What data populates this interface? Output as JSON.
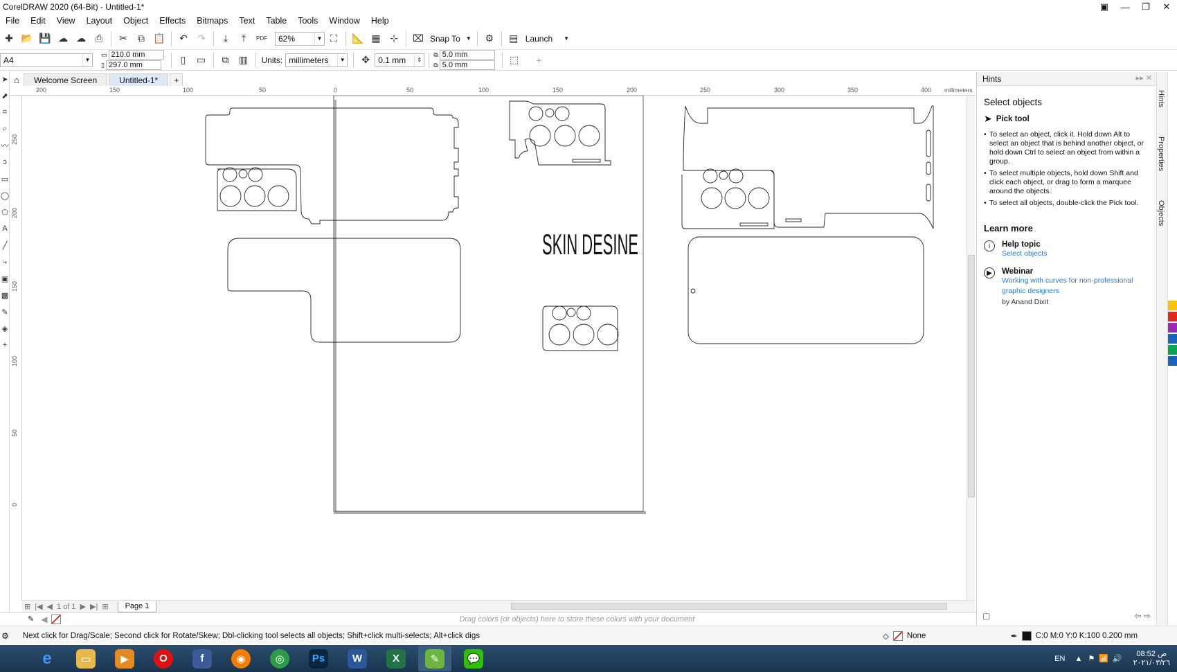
{
  "app": {
    "title": "CorelDRAW 2020 (64-Bit) - Untitled-1*"
  },
  "menu": [
    "File",
    "Edit",
    "View",
    "Layout",
    "Object",
    "Effects",
    "Bitmaps",
    "Text",
    "Table",
    "Tools",
    "Window",
    "Help"
  ],
  "toolbar": {
    "zoom": "62%",
    "snap_to": "Snap To",
    "launch": "Launch",
    "pdf": "PDF"
  },
  "property_bar": {
    "page_preset": "A4",
    "width": "210.0 mm",
    "height": "297.0 mm",
    "units_label": "Units:",
    "units_value": "millimeters",
    "nudge": "0.1 mm",
    "dup_x": "5.0 mm",
    "dup_y": "5.0 mm"
  },
  "doc_tabs": [
    "Welcome Screen",
    "Untitled-1*"
  ],
  "ruler": {
    "unit": "millimeters",
    "h_ticks": [
      "200",
      "150",
      "100",
      "50",
      "0",
      "50",
      "100",
      "150",
      "200",
      "250",
      "300",
      "350",
      "400"
    ],
    "v_ticks": [
      "250",
      "200",
      "150",
      "100",
      "50",
      "0"
    ]
  },
  "canvas": {
    "text": "SKIN DESINE"
  },
  "page_nav": {
    "count": "1 of 1",
    "page_tab": "Page 1"
  },
  "palette_hint": "Drag colors (or objects) here to store these colors with your document",
  "status": {
    "message": "Next click for Drag/Scale; Second click for Rotate/Skew; Dbl-clicking tool selects all objects; Shift+click multi-selects; Alt+click digs",
    "fill": "None",
    "outline": "C:0 M:0 Y:0 K:100  0.200 mm"
  },
  "hints": {
    "panel_title": "Hints",
    "heading": "Select objects",
    "tool": "Pick tool",
    "bullets": [
      "To select an object, click it. Hold down Alt to select an object that is behind another object, or hold down Ctrl to select an object from within a group.",
      "To select multiple objects, hold down Shift and click each object, or drag to form a marquee around the objects.",
      "To select all objects, double-click the Pick tool."
    ],
    "learn_more": "Learn more",
    "help_topic": "Help topic",
    "help_link": "Select objects",
    "webinar": "Webinar",
    "webinar_link": "Working with curves for non-professional graphic designers",
    "webinar_by": "by Anand Dixit"
  },
  "docker_tabs": [
    "Hints",
    "Properties",
    "Objects"
  ],
  "tray": {
    "lang": "EN",
    "time": "08:52 ص",
    "date": "٢٠٢١/٠٣/٢٦"
  },
  "colors": {
    "accent": "#2b7bd0",
    "taskbar": "#1f3b5a"
  }
}
